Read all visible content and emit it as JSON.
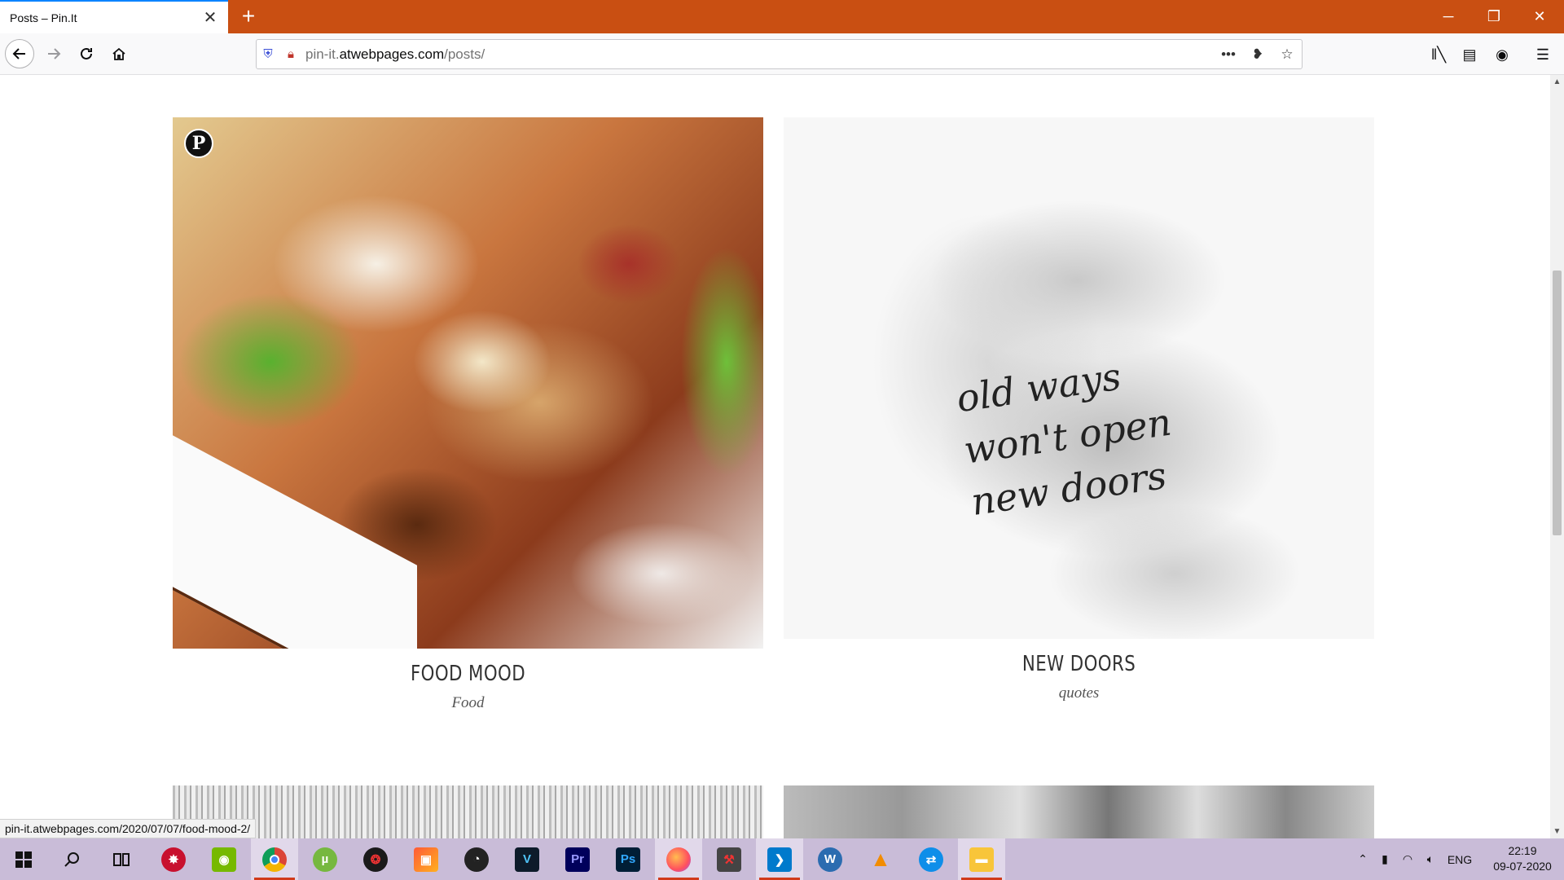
{
  "browser": {
    "tab_title": "Posts – Pin.It",
    "tab_close": "✕",
    "new_tab": "+",
    "url_host_prefix": "pin-it.",
    "url_host": "atwebpages.com",
    "url_path": "/posts/",
    "status_url": "pin-it.atwebpages.com/2020/07/07/food-mood-2/"
  },
  "posts": [
    {
      "title": "FOOD MOOD",
      "category": "Food",
      "pin_badge": "P"
    },
    {
      "title": "NEW DOORS",
      "category": "quotes",
      "quote_lines": [
        "old ways",
        "won't open",
        "new doors"
      ]
    }
  ],
  "taskbar": {
    "language": "ENG",
    "time": "22:19",
    "date": "09-07-2020",
    "apps": [
      {
        "name": "start",
        "icon": "windows-icon"
      },
      {
        "name": "search",
        "icon": "search-icon"
      },
      {
        "name": "task-view",
        "icon": "task-view-icon"
      },
      {
        "name": "app-red",
        "icon": "red-app-icon"
      },
      {
        "name": "nvidia",
        "icon": "nvidia-icon"
      },
      {
        "name": "chrome",
        "icon": "chrome-icon"
      },
      {
        "name": "utorrent",
        "icon": "utorrent-icon"
      },
      {
        "name": "app-shield",
        "icon": "shield-app-icon"
      },
      {
        "name": "app-box",
        "icon": "box-app-icon"
      },
      {
        "name": "app-speed",
        "icon": "speedometer-icon"
      },
      {
        "name": "vegas",
        "icon": "vegas-icon",
        "label": "V"
      },
      {
        "name": "premiere",
        "icon": "premiere-icon",
        "label": "Pr"
      },
      {
        "name": "photoshop",
        "icon": "photoshop-icon",
        "label": "Ps"
      },
      {
        "name": "firefox",
        "icon": "firefox-icon"
      },
      {
        "name": "app-toolbox",
        "icon": "toolbox-icon"
      },
      {
        "name": "vscode",
        "icon": "vscode-icon"
      },
      {
        "name": "app-w",
        "icon": "w-app-icon",
        "label": "W"
      },
      {
        "name": "vlc",
        "icon": "vlc-icon"
      },
      {
        "name": "teamviewer",
        "icon": "teamviewer-icon"
      },
      {
        "name": "file-explorer",
        "icon": "folder-icon"
      }
    ]
  }
}
